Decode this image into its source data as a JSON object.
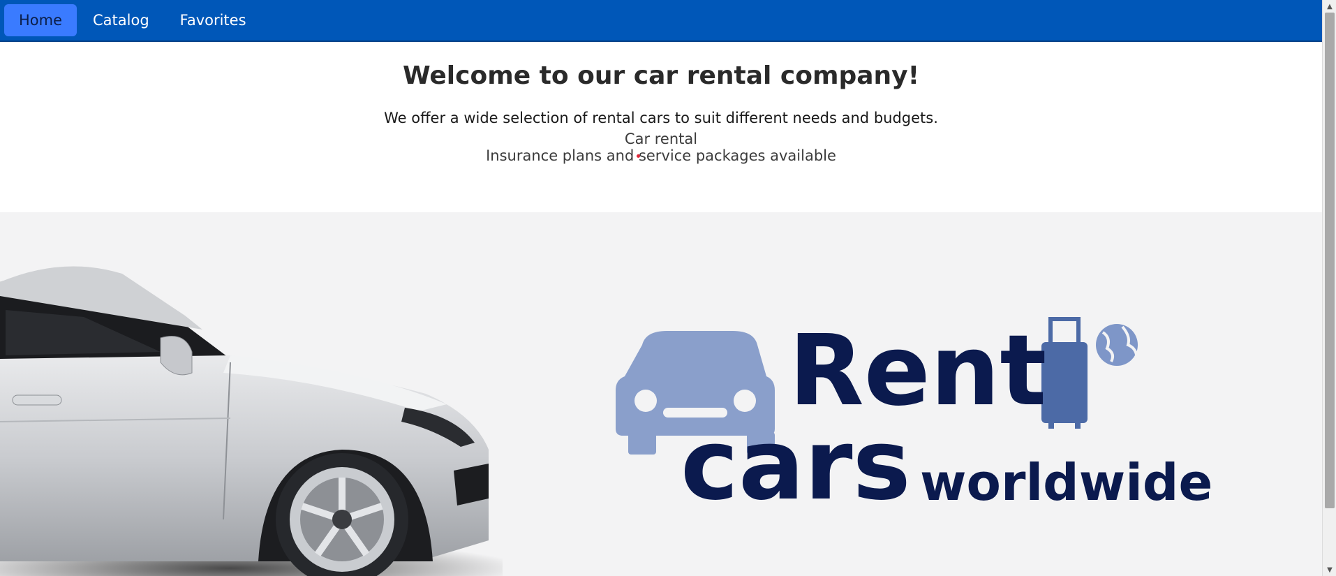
{
  "nav": {
    "items": [
      {
        "label": "Home",
        "active": true
      },
      {
        "label": "Catalog",
        "active": false
      },
      {
        "label": "Favorites",
        "active": false
      }
    ]
  },
  "hero": {
    "title": "Welcome to our car rental company!",
    "lead": "We offer a wide selection of rental cars to suit different needs and budgets.",
    "line1": "Car rental",
    "line2": "Insurance plans and service packages available"
  },
  "banner": {
    "logo_word1": "Rent",
    "logo_word2": "cars",
    "logo_word3": "worldwide"
  },
  "colors": {
    "nav_bg": "#0057b8",
    "nav_active": "#3a7bff",
    "logo_dark": "#0b1a4e",
    "logo_light": "#8a9fcb",
    "suitcase": "#4c6aa6"
  }
}
